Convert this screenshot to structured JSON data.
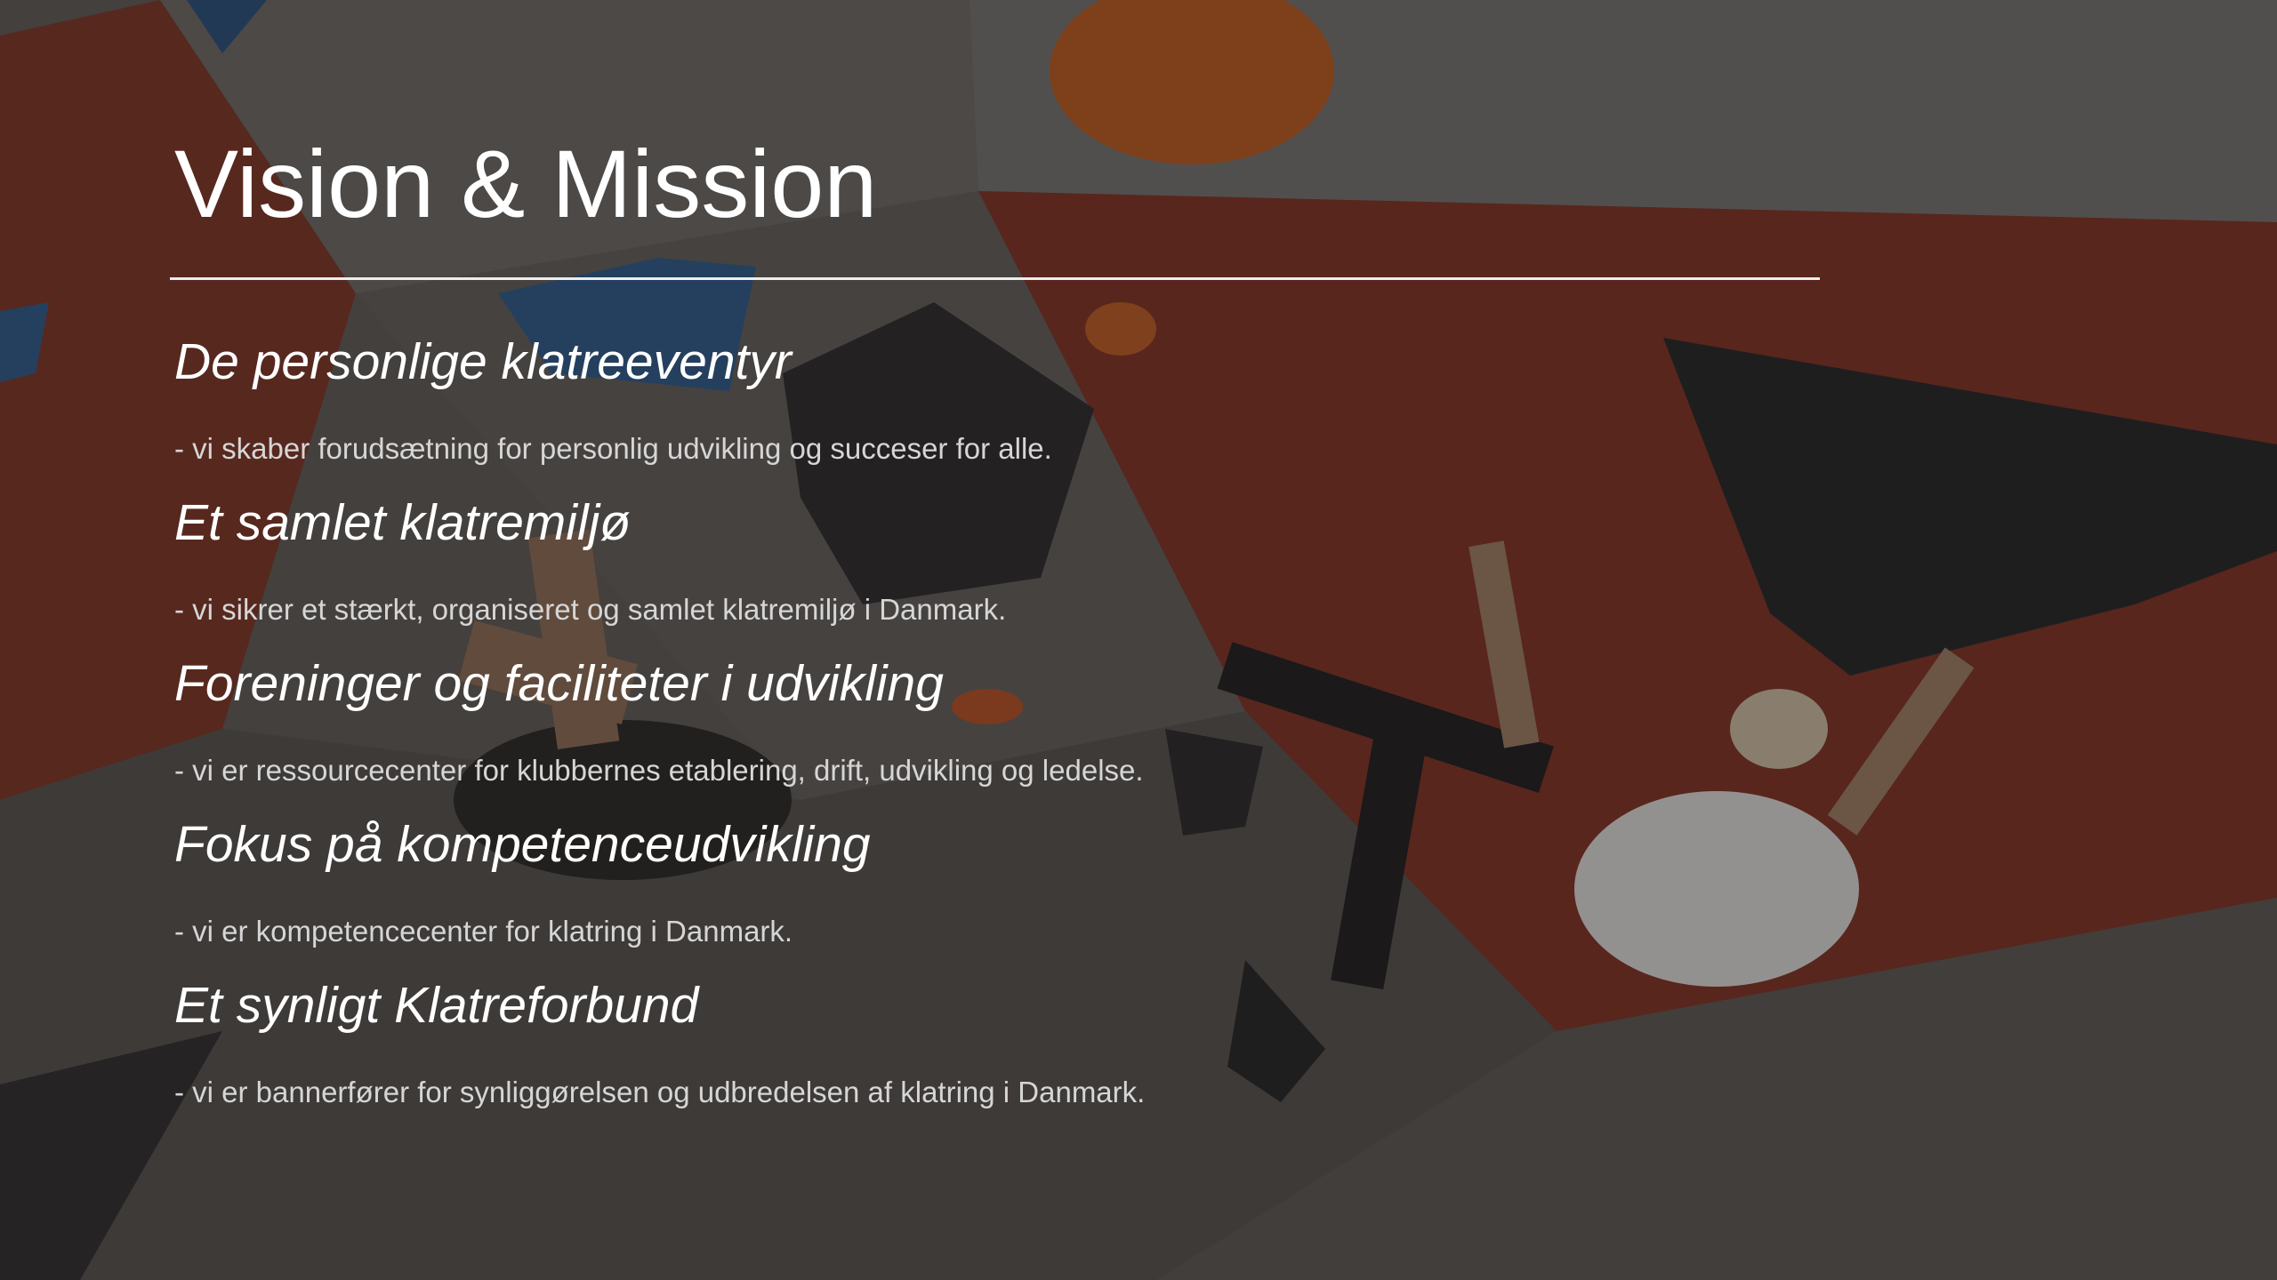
{
  "slide": {
    "title": "Vision & Mission",
    "background_image": "indoor bouldering wall with climbers, darkened",
    "colors": {
      "title": "#ffffff",
      "heading": "#ffffff",
      "description": "#d6d6d6",
      "rule": "#eeeeee"
    },
    "items": [
      {
        "heading": "De personlige klatreeventyr",
        "description": "- vi skaber forudsætning for personlig udvikling og succeser for alle."
      },
      {
        "heading": "Et samlet klatremiljø",
        "description": "- vi sikrer et stærkt, organiseret og samlet klatremiljø i Danmark."
      },
      {
        "heading": "Foreninger og faciliteter i udvikling",
        "description": "- vi er ressourcecenter for klubbernes etablering, drift, udvikling og ledelse."
      },
      {
        "heading": "Fokus på kompetenceudvikling",
        "description": "- vi er kompetencecenter for klatring i Danmark."
      },
      {
        "heading": "Et synligt Klatreforbund",
        "description": "- vi er bannerfører for synliggørelsen og udbredelsen af klatring i Danmark."
      }
    ]
  }
}
